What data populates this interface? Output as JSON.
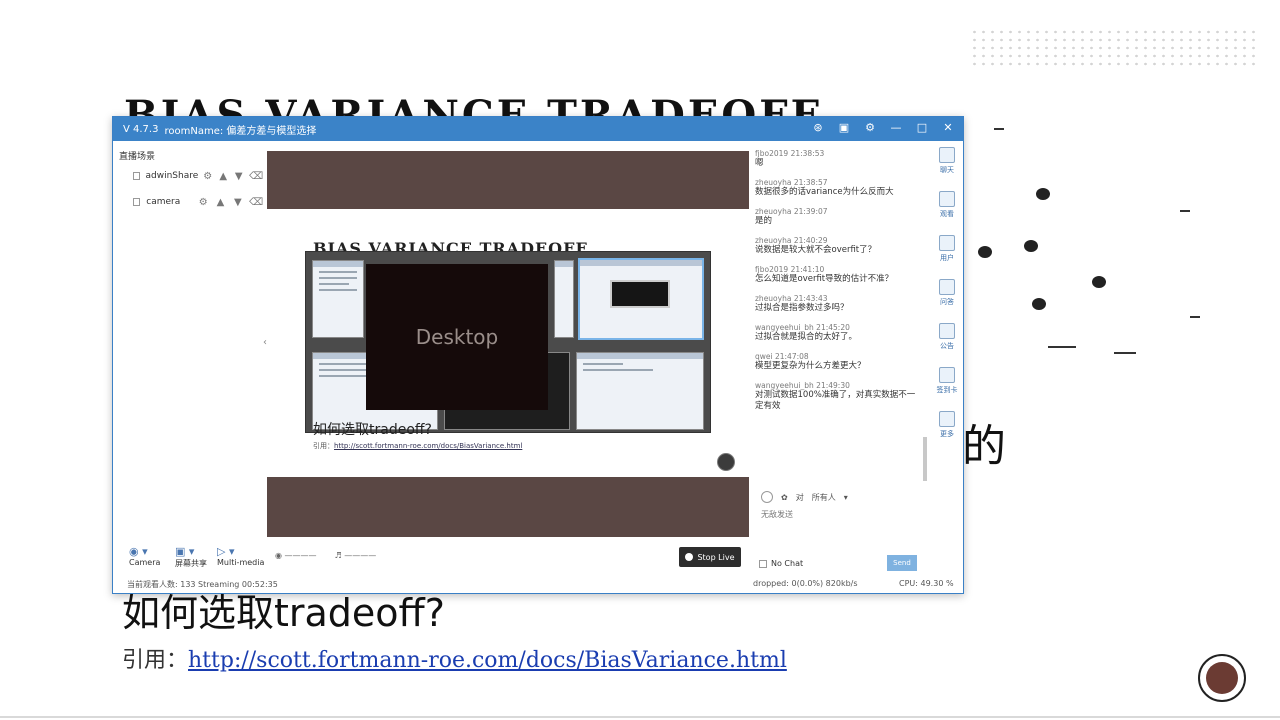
{
  "slide": {
    "title": "BIAS VARIANCE TRADEOFF",
    "de_char": "的",
    "question": "如何选取tradeoff?",
    "ref_label": "引用：",
    "ref_url": "http://scott.fortmann-roe.com/docs/BiasVariance.html"
  },
  "app": {
    "version": "V 4.7.3",
    "room": "roomName: 偏差方差与模型选择",
    "title_icons": [
      "minimize-to-tray-icon",
      "screenshot-icon",
      "settings-icon",
      "minimize-icon",
      "maximize-icon",
      "close-icon"
    ],
    "scenes_heading": "直播场景",
    "scenes": [
      {
        "name": "adwinShare"
      },
      {
        "name": "camera"
      }
    ],
    "preview": {
      "mini_title": "BIAS VARIANCE TRADEOFF",
      "desktop_label": "Desktop",
      "mini_question": "如何选取tradeoff?",
      "mini_ref": "引用：",
      "mini_ref_url": "http://scott.fortmann-roe.com/docs/BiasVariance.html"
    },
    "chat": [
      {
        "user": "fjbo2019",
        "time": "21:38:53",
        "text": "嗯"
      },
      {
        "user": "zheuoyha",
        "time": "21:38:57",
        "text": "数据很多的话variance为什么反而大"
      },
      {
        "user": "zheuoyha",
        "time": "21:39:07",
        "text": "是的"
      },
      {
        "user": "zheuoyha",
        "time": "21:40:29",
        "text": "说数据是较大就不会overfit了？"
      },
      {
        "user": "fjbo2019",
        "time": "21:41:10",
        "text": "怎么知道是overfit导致的估计不准？"
      },
      {
        "user": "zheuoyha",
        "time": "21:43:43",
        "text": "过拟合是指参数过多吗？"
      },
      {
        "user": "wangyeehui_bh",
        "time": "21:45:20",
        "text": "过拟合就是拟合的太好了。"
      },
      {
        "user": "qwei",
        "time": "21:47:08",
        "text": "模型更复杂为什么方差更大？"
      },
      {
        "user": "wangyeehui_bh",
        "time": "21:49:30",
        "text": "对测试数据100%准确了，对真实数据不一定有效"
      }
    ],
    "chat_input": {
      "to": "对",
      "target": "所有人",
      "emoji": "表情",
      "send_hint": "无敌发送"
    },
    "side_tabs": [
      {
        "label": "聊天",
        "icon": "chat-icon"
      },
      {
        "label": "观看",
        "icon": "viewers-icon"
      },
      {
        "label": "用户",
        "icon": "users-icon"
      },
      {
        "label": "问答",
        "icon": "qa-icon"
      },
      {
        "label": "公告",
        "icon": "announce-icon"
      },
      {
        "label": "签到卡",
        "icon": "checkin-icon"
      },
      {
        "label": "更多",
        "icon": "more-icon"
      }
    ],
    "tools": [
      {
        "label": "Camera",
        "icon": "camera-icon"
      },
      {
        "label": "屏幕共享",
        "icon": "screen-share-icon"
      },
      {
        "label": "Multi-media",
        "icon": "multimedia-icon"
      }
    ],
    "mic_label": "————",
    "speaker_label": "————",
    "live_button": "Stop Live",
    "no_chat": "No Chat",
    "send_button": "Send",
    "status_left": "当前观看人数: 133   Streaming  00:52:35",
    "status_mid": "dropped: 0(0.0%)   820kb/s",
    "status_right": "CPU: 49.30 %"
  }
}
